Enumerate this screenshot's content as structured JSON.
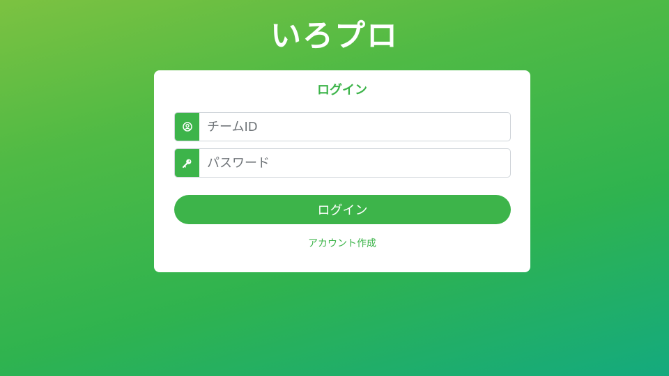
{
  "app": {
    "title": "いろプロ"
  },
  "login_card": {
    "title": "ログイン",
    "team_id": {
      "placeholder": "チームID",
      "value": "",
      "icon": "user-circle-icon"
    },
    "password": {
      "placeholder": "パスワード",
      "value": "",
      "icon": "key-icon"
    },
    "submit_label": "ログイン",
    "create_account_label": "アカウント作成"
  },
  "colors": {
    "accent": "#3db44a",
    "background_gradient_start": "#7cc241",
    "background_gradient_end": "#14aa7e",
    "card": "#ffffff"
  }
}
